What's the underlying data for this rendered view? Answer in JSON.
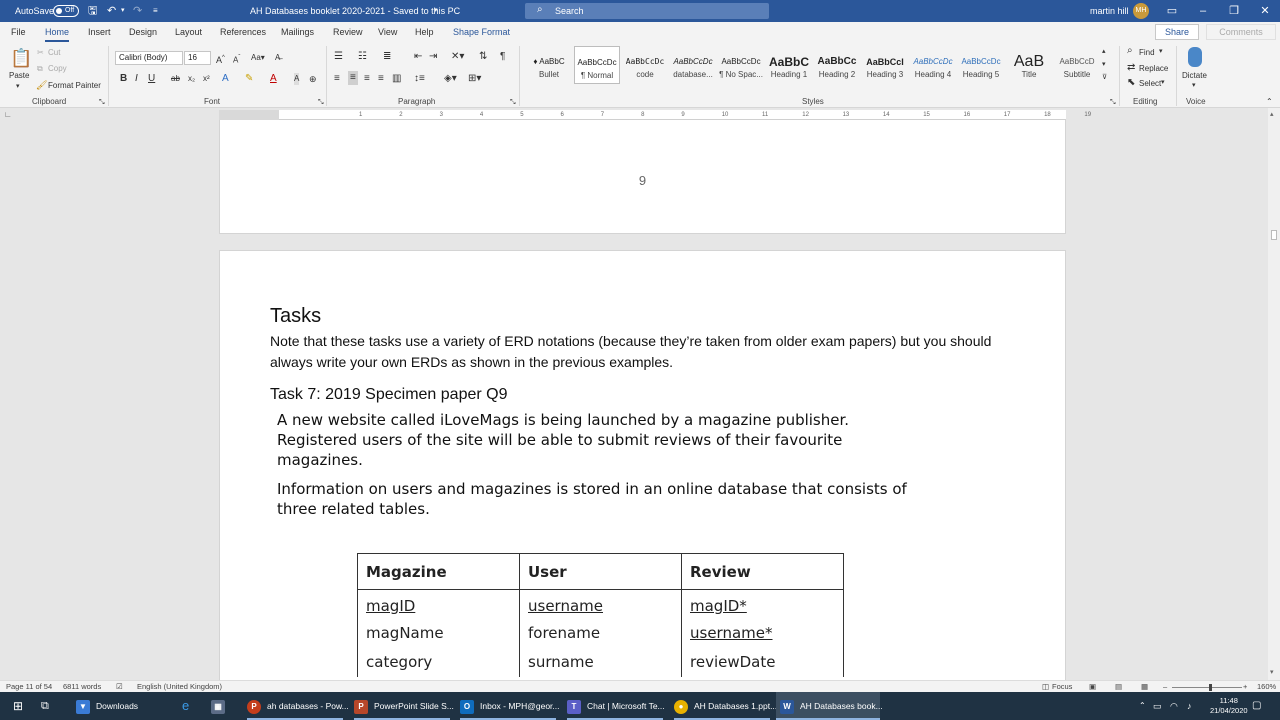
{
  "titlebar": {
    "autosave_label": "AutoSave",
    "autosave_state": "Off",
    "doc_title": "AH Databases booklet 2020-2021  -  Saved to this PC",
    "search_placeholder": "Search",
    "user_name": "martin hill",
    "user_initials": "MH"
  },
  "ribbon_tabs": [
    "File",
    "Home",
    "Insert",
    "Design",
    "Layout",
    "References",
    "Mailings",
    "Review",
    "View",
    "Help",
    "Shape Format"
  ],
  "active_tab": "Home",
  "share_label": "Share",
  "comments_label": "Comments",
  "clipboard": {
    "paste": "Paste",
    "cut": "Cut",
    "copy": "Copy",
    "format_painter": "Format Painter",
    "group": "Clipboard"
  },
  "font": {
    "family": "Calibri (Body)",
    "size": "16",
    "group": "Font"
  },
  "paragraph": {
    "group": "Paragraph"
  },
  "styles": {
    "group": "Styles",
    "items": [
      {
        "sample": "♦  AaBbC",
        "name": "Bullet"
      },
      {
        "sample": "AaBbCcDc",
        "name": "¶ Normal"
      },
      {
        "sample": "AaBbCcDc",
        "name": "code"
      },
      {
        "sample": "AaBbCcDc",
        "name": "database..."
      },
      {
        "sample": "AaBbCcDc",
        "name": "¶ No Spac..."
      },
      {
        "sample": "AaBbC",
        "name": "Heading 1"
      },
      {
        "sample": "AaBbCc",
        "name": "Heading 2"
      },
      {
        "sample": "AaBbCcI",
        "name": "Heading 3"
      },
      {
        "sample": "AaBbCcDc",
        "name": "Heading 4"
      },
      {
        "sample": "AaBbCcDc",
        "name": "Heading 5"
      },
      {
        "sample": "AaB",
        "name": "Title"
      },
      {
        "sample": "AaBbCcD",
        "name": "Subtitle"
      }
    ]
  },
  "editing": {
    "find": "Find",
    "replace": "Replace",
    "select": "Select",
    "group": "Editing"
  },
  "voice": {
    "dictate": "Dictate",
    "group": "Voice"
  },
  "ruler_numbers": [
    "1",
    "1",
    "2",
    "3",
    "4",
    "5",
    "6",
    "7",
    "8",
    "9",
    "10",
    "11",
    "12",
    "13",
    "14",
    "15",
    "16",
    "17",
    "18",
    "19"
  ],
  "document": {
    "page_number": "9",
    "heading_tasks": "Tasks",
    "intro_line1": "Note that these tasks use a variety of ERD notations (because they’re taken from older exam papers) but you should",
    "intro_line2": "always write your own ERDs as shown in the previous examples.",
    "heading_task7": "Task 7: 2019 Specimen paper Q9",
    "para1_line1": "A new website called iLoveMags is being launched by a magazine publisher.",
    "para1_line2": "Registered users of the site will be able to submit reviews of their favourite",
    "para1_line3": "magazines.",
    "para2_line1": "Information on users and magazines is stored in an online database that consists of",
    "para2_line2": "three related tables.",
    "table": {
      "headers": [
        "Magazine",
        "User",
        "Review"
      ],
      "rows": [
        [
          "magID",
          "username",
          "magID*"
        ],
        [
          "magName",
          "forename",
          "username*"
        ],
        [
          "category",
          "surname",
          "reviewDate"
        ]
      ]
    }
  },
  "statusbar": {
    "page": "Page 11 of 54",
    "words": "6811 words",
    "language": "English (United Kingdom)",
    "focus": "Focus",
    "zoom": "160%"
  },
  "taskbar": {
    "apps": [
      {
        "label": "Downloads"
      },
      {
        "label": "ah databases - Pow..."
      },
      {
        "label": "PowerPoint Slide S..."
      },
      {
        "label": "Inbox - MPH@geor..."
      },
      {
        "label": "Chat | Microsoft Te..."
      },
      {
        "label": "AH Databases 1.ppt..."
      },
      {
        "label": "AH Databases book..."
      }
    ],
    "time": "11:48",
    "date": "21/04/2020"
  }
}
